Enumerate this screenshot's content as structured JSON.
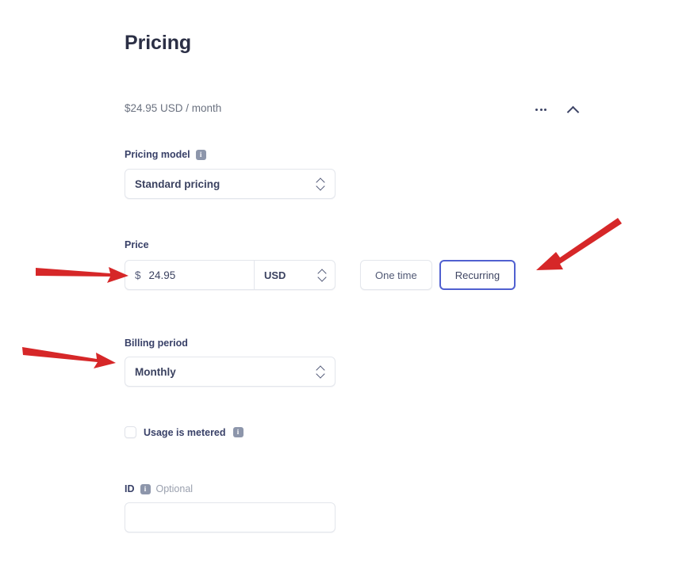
{
  "page": {
    "title": "Pricing"
  },
  "summary": {
    "text": "$24.95 USD / month",
    "more_icon": "ellipsis-icon",
    "collapse_icon": "chevron-up-icon"
  },
  "pricing_model": {
    "label": "Pricing model",
    "info_icon": "info-icon",
    "info_glyph": "i",
    "value": "Standard pricing",
    "options": [
      "Standard pricing"
    ]
  },
  "price": {
    "label": "Price",
    "currency_symbol": "$",
    "value": "24.95",
    "currency": "USD",
    "currency_options": [
      "USD"
    ]
  },
  "charge_type": {
    "one_time_label": "One time",
    "recurring_label": "Recurring",
    "selected": "Recurring"
  },
  "billing_period": {
    "label": "Billing period",
    "value": "Monthly",
    "options": [
      "Monthly"
    ]
  },
  "metered": {
    "label": "Usage is metered",
    "checked": false,
    "info_glyph": "i"
  },
  "id_field": {
    "label": "ID",
    "optional_text": "Optional",
    "value": "",
    "placeholder": "",
    "info_glyph": "i"
  },
  "annotations": {
    "color": "#d62728",
    "arrows": [
      {
        "name": "arrow-to-price-field"
      },
      {
        "name": "arrow-to-recurring-button"
      },
      {
        "name": "arrow-to-billing-period"
      }
    ]
  }
}
